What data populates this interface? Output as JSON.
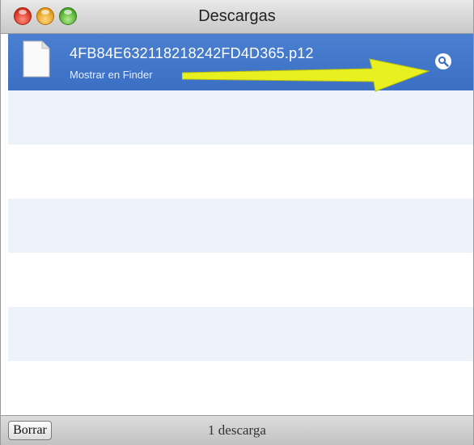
{
  "window": {
    "title": "Descargas"
  },
  "downloads": [
    {
      "filename": "4FB84E632118218242FD4D365.p12",
      "action": "Mostrar en Finder",
      "selected": true
    }
  ],
  "icons": {
    "file": "document-icon",
    "reveal": "magnifier-icon",
    "annotation": "arrow-icon"
  },
  "colors": {
    "selection": "#3f73c9",
    "stripe": "#eef2fb",
    "arrow": "#e8f020"
  },
  "footer": {
    "clear_label": "Borrar",
    "status": "1 descarga"
  }
}
